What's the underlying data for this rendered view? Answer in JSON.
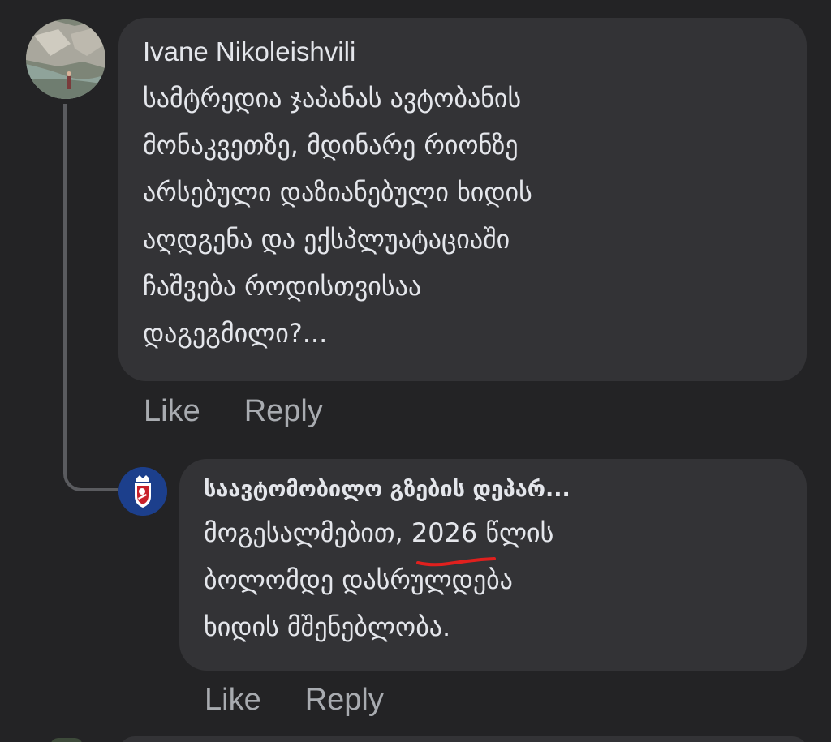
{
  "comment": {
    "author": "Ivane Nikoleishvili",
    "lines": [
      "სამტრედია ჯაპანას ავტობანის",
      "მონაკვეთზე, მდინარე რიონზე",
      "არსებული დაზიანებული ხიდის",
      "აღდგენა და ექსპლუატაციაში",
      "ჩაშვება როდისთვისაა",
      "დაგეგმილი?..."
    ],
    "actions": {
      "like": "Like",
      "reply": "Reply"
    }
  },
  "reply": {
    "author": "საავტომობილო გზების დეპარ...",
    "line1_before": "მოგესალმებით, ",
    "line1_year": "2026",
    "line1_after": " წლის",
    "lines": [
      "ბოლომდე დასრულდება",
      "ხიდის მშენებლობა."
    ],
    "actions": {
      "like": "Like",
      "reply": "Reply"
    }
  },
  "colors": {
    "background": "#232325",
    "bubble": "#333336",
    "text": "#e4e6eb",
    "action_text": "#a8abb0",
    "underline_mark": "#e0201e",
    "logo_blue": "#1c3f8c"
  },
  "icons": {
    "commenter_avatar": "landscape-photo",
    "department_avatar": "georgia-coat-of-arms-logo"
  }
}
